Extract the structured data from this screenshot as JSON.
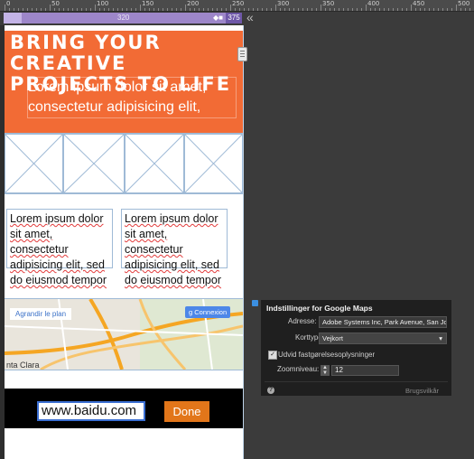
{
  "ruler": {
    "labels": [
      "0",
      "50",
      "100",
      "150",
      "200",
      "250",
      "300",
      "350",
      "400",
      "450",
      "500"
    ]
  },
  "media_bar": {
    "left_value": "320",
    "right_value": "375",
    "collapse_glyph": "«"
  },
  "page": {
    "hero_title": "BRING YOUR CREATIVE PROJECTS TO LIFE",
    "hero_lead": "Lorem ipsum dolor sit amet, consectetur adipisicing elit,",
    "columns": [
      "Lorem ipsum dolor sit amet, consectetur adipisicing elit, sed do eiusmod tempor",
      "Lorem ipsum dolor sit amet, consectetur adipisicing elit, sed do eiusmod tempor"
    ],
    "map": {
      "enlarge_link": "Agrandir le plan",
      "connect_button": "Connexion",
      "city_label": "nta Clara"
    },
    "footer": {
      "url_value": "www.baidu.com",
      "done_label": "Done"
    }
  },
  "gmaps_panel": {
    "title": "Indstillinger for Google Maps",
    "address_label": "Adresse:",
    "address_value": "Adobe Systems Inc, Park Avenue, San Jo",
    "maptype_label": "Korttype:",
    "maptype_value": "Vejkort",
    "checkbox_label": "Udvid fastgørelsesoplysninger",
    "zoom_label": "Zoomniveau:",
    "zoom_value": "12",
    "help_glyph": "?",
    "terms_link": "Brugsvilkår"
  },
  "colors": {
    "hero": "#f26b35",
    "media_bar": "#9d86c9",
    "done": "#e2761a",
    "panel": "#1f1f1f"
  },
  "icons": [
    "collapse-chevrons-icon",
    "scroll-handle-icon",
    "google-plus-icon",
    "dropdown-arrow-icon",
    "help-icon",
    "checkbox-checked-icon"
  ]
}
